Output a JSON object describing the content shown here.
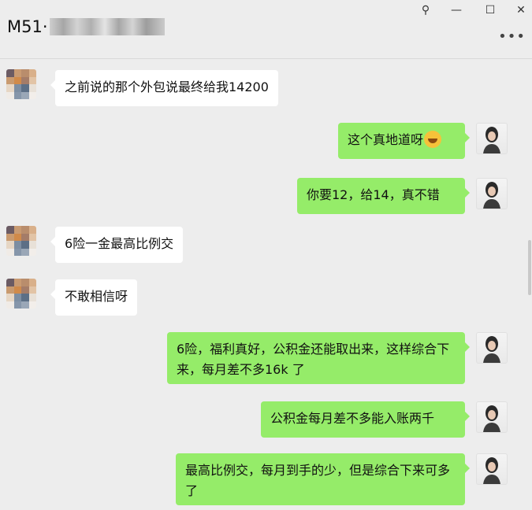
{
  "window": {
    "title_visible": "M51·",
    "buttons": {
      "pin": "⚲",
      "minimize": "—",
      "maximize": "☐",
      "close": "✕"
    },
    "more": "•••"
  },
  "messages": [
    {
      "side": "in",
      "text": "之前说的那个外包说最终给我14200"
    },
    {
      "side": "out",
      "text": "这个真地道呀",
      "emoji": "laughing-face-emoji"
    },
    {
      "side": "out",
      "text": "你要12，给14，真不错"
    },
    {
      "side": "in",
      "text": "6险一金最高比例交"
    },
    {
      "side": "in",
      "text": "不敢相信呀"
    },
    {
      "side": "out",
      "text": "6险，福利真好，公积金还能取出来，这样综合下来，每月差不多16k 了"
    },
    {
      "side": "out",
      "text": "公积金每月差不多能入账两千"
    },
    {
      "side": "out",
      "text": "最高比例交，每月到手的少，但是综合下来可多了"
    }
  ],
  "colors": {
    "background": "#ededed",
    "bubble_in": "#ffffff",
    "bubble_out": "#95ec69"
  }
}
